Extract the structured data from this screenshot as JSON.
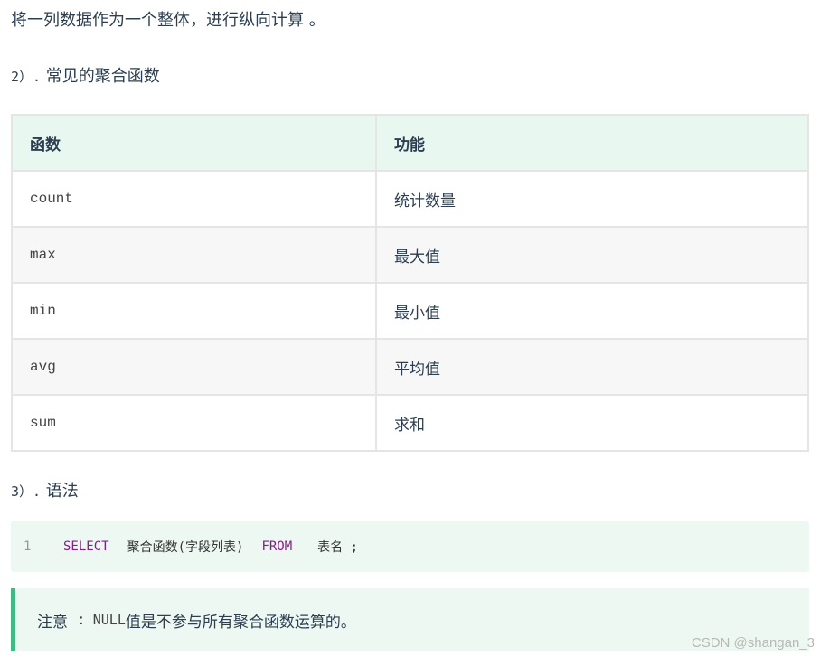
{
  "intro": "将一列数据作为一个整体，进行纵向计算 。",
  "section2": {
    "number": "2）.",
    "title": "常见的聚合函数"
  },
  "table": {
    "headers": [
      "函数",
      "功能"
    ],
    "rows": [
      {
        "func": "count",
        "desc": "统计数量"
      },
      {
        "func": "max",
        "desc": "最大值"
      },
      {
        "func": "min",
        "desc": "最小值"
      },
      {
        "func": "avg",
        "desc": "平均值"
      },
      {
        "func": "sum",
        "desc": "求和"
      }
    ]
  },
  "section3": {
    "number": "3）.",
    "title": "语法"
  },
  "code": {
    "line_number": "1",
    "kw_select": "SELECT",
    "fragment1": "聚合函数(字段列表)",
    "kw_from": "FROM",
    "fragment2": "表名 ;"
  },
  "note": {
    "label": "注意",
    "colon": ":",
    "null_word": "NULL",
    "text": "值是不参与所有聚合函数运算的。"
  },
  "watermark": "CSDN @shangan_3",
  "colors": {
    "accent": "#42b983",
    "header_bg": "#e8f7f0",
    "code_bg": "#eef8f3",
    "keyword": "#8b1a8b"
  }
}
